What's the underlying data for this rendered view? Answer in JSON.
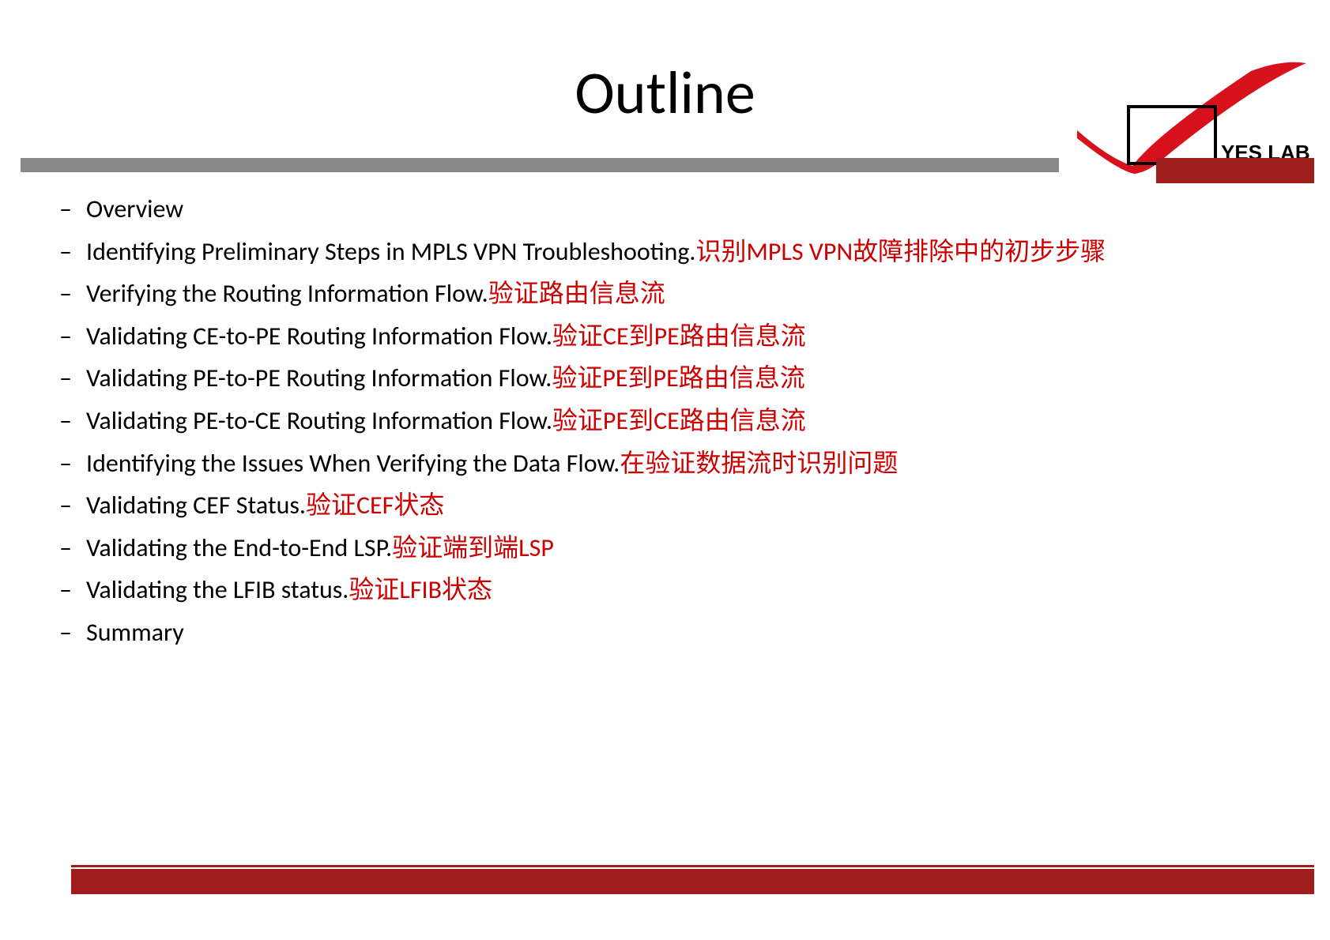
{
  "title": "Outline",
  "logo_text": "YES LAB",
  "bullets": [
    {
      "en": "Overview",
      "zh": ""
    },
    {
      "en": "Identifying Preliminary Steps in MPLS VPN Troubleshooting.",
      "zh": "识别MPLS VPN故障排除中的初步步骤"
    },
    {
      "en": "Verifying the Routing Information Flow.",
      "zh": "验证路由信息流"
    },
    {
      "en": "Validating CE-to-PE Routing Information Flow.",
      "zh": "验证CE到PE路由信息流"
    },
    {
      "en": "Validating PE-to-PE Routing Information Flow.",
      "zh": "验证PE到PE路由信息流"
    },
    {
      "en": "Validating PE-to-CE Routing Information Flow.",
      "zh": "验证PE到CE路由信息流"
    },
    {
      "en": "Identifying the Issues When Verifying the Data Flow.",
      "zh": "在验证数据流时识别问题"
    },
    {
      "en": "Validating CEF Status.",
      "zh": "验证CEF状态"
    },
    {
      "en": "Validating the End-to-End LSP.",
      "zh": "验证端到端LSP"
    },
    {
      "en": "Validating the LFIB status.",
      "zh": "验证LFIB状态"
    },
    {
      "en": "Summary",
      "zh": ""
    }
  ]
}
